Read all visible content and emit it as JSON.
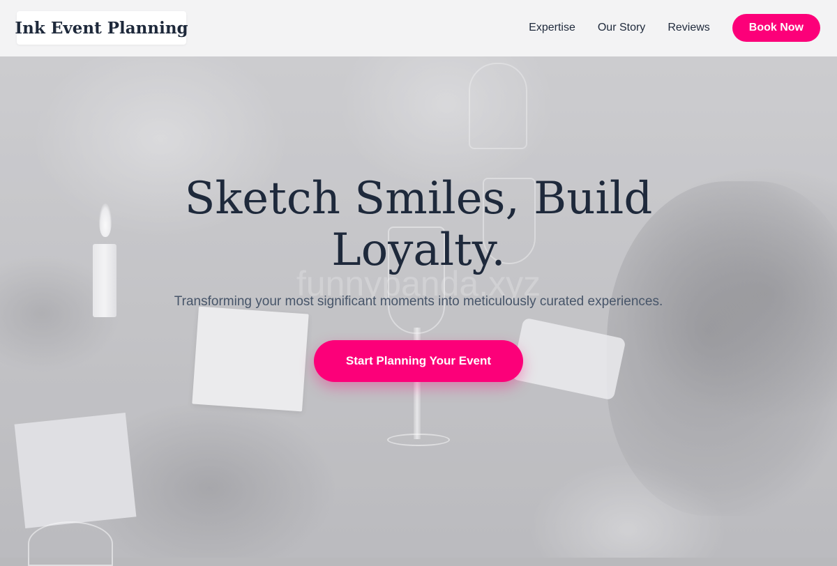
{
  "header": {
    "brand": "Ink Event Planning",
    "nav": [
      {
        "label": "Expertise"
      },
      {
        "label": "Our Story"
      },
      {
        "label": "Reviews"
      }
    ],
    "cta_label": "Book Now"
  },
  "hero": {
    "title": "Sketch Smiles, Build Loyalty.",
    "subtitle": "Transforming your most significant moments into meticulously curated experiences.",
    "cta_label": "Start Planning Your Event",
    "watermark": "funnypanda.xyz",
    "background": "blurred monochrome wedding reception scene with raised champagne glasses"
  },
  "colors": {
    "accent": "#fc0079",
    "heading": "#1e293b",
    "subtitle": "#475569",
    "header_bg": "#f5f5f6"
  }
}
